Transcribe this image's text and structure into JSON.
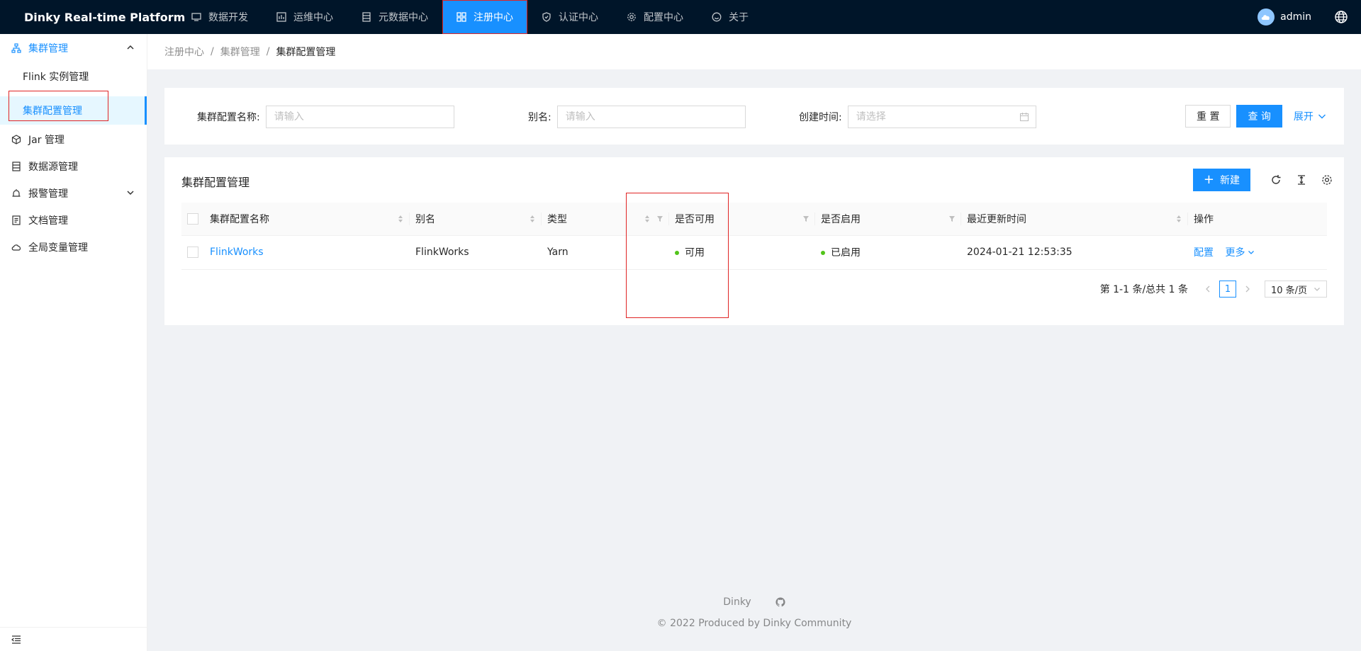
{
  "app": {
    "title": "Dinky Real-time Platform"
  },
  "nav": {
    "items": [
      {
        "label": "数据开发",
        "icon": "monitor-icon"
      },
      {
        "label": "运维中心",
        "icon": "dashboard-icon"
      },
      {
        "label": "元数据中心",
        "icon": "database-icon"
      },
      {
        "label": "注册中心",
        "icon": "appstore-icon",
        "active": true
      },
      {
        "label": "认证中心",
        "icon": "shield-icon"
      },
      {
        "label": "配置中心",
        "icon": "gear-icon"
      },
      {
        "label": "关于",
        "icon": "smile-icon"
      }
    ],
    "user": "admin"
  },
  "sidebar": {
    "group": {
      "label": "集群管理"
    },
    "subitems": [
      {
        "label": "Flink 实例管理"
      },
      {
        "label": "集群配置管理",
        "active": true
      }
    ],
    "items": [
      {
        "label": "Jar 管理"
      },
      {
        "label": "数据源管理"
      },
      {
        "label": "报警管理"
      },
      {
        "label": "文档管理"
      },
      {
        "label": "全局变量管理"
      }
    ]
  },
  "breadcrumb": [
    "注册中心",
    "集群管理",
    "集群配置管理"
  ],
  "search": {
    "name_label": "集群配置名称:",
    "name_placeholder": "请输入",
    "alias_label": "别名:",
    "alias_placeholder": "请输入",
    "created_label": "创建时间:",
    "created_placeholder": "请选择",
    "reset_label": "重 置",
    "query_label": "查 询",
    "expand_label": "展开"
  },
  "table": {
    "title": "集群配置管理",
    "new_label": "新建",
    "columns": [
      "集群配置名称",
      "别名",
      "类型",
      "是否可用",
      "是否启用",
      "最近更新时间",
      "操作"
    ],
    "rows": [
      {
        "name": "FlinkWorks",
        "alias": "FlinkWorks",
        "type": "Yarn",
        "available": "可用",
        "enabled": "已启用",
        "updated": "2024-01-21 12:53:35",
        "action_config": "配置",
        "action_more": "更多"
      }
    ],
    "pagination": {
      "total_text": "第 1-1 条/总共 1 条",
      "current": "1",
      "page_size": "10 条/页"
    }
  },
  "footer": {
    "brand": "Dinky",
    "copyright": "2022 Produced by Dinky Community"
  },
  "colors": {
    "primary": "#1890ff",
    "header": "#001529",
    "success": "#52c41a",
    "highlight": "#e02424"
  }
}
